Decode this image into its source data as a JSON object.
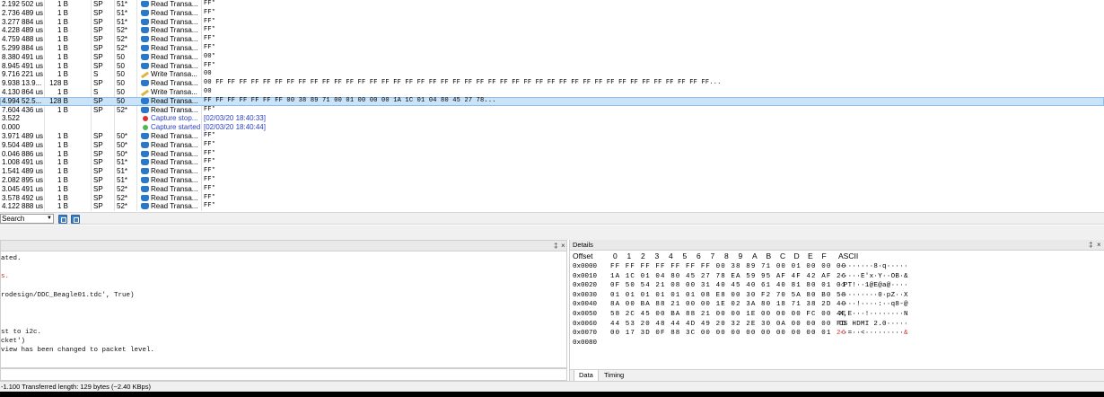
{
  "packets": [
    {
      "time": "2.192",
      "duration": "502 us",
      "length": "1 B",
      "record": "SP",
      "addr": "51*",
      "type": "read",
      "summary": "Read Transa...",
      "data": "FF*"
    },
    {
      "time": "2.736",
      "duration": "489 us",
      "length": "1 B",
      "record": "SP",
      "addr": "51*",
      "type": "read",
      "summary": "Read Transa...",
      "data": "FF*"
    },
    {
      "time": "3.277",
      "duration": "884 us",
      "length": "1 B",
      "record": "SP",
      "addr": "51*",
      "type": "read",
      "summary": "Read Transa...",
      "data": "FF*"
    },
    {
      "time": "4.228",
      "duration": "489 us",
      "length": "1 B",
      "record": "SP",
      "addr": "52*",
      "type": "read",
      "summary": "Read Transa...",
      "data": "FF*"
    },
    {
      "time": "4.759",
      "duration": "488 us",
      "length": "1 B",
      "record": "SP",
      "addr": "52*",
      "type": "read",
      "summary": "Read Transa...",
      "data": "FF*"
    },
    {
      "time": "5.299",
      "duration": "884 us",
      "length": "1 B",
      "record": "SP",
      "addr": "52*",
      "type": "read",
      "summary": "Read Transa...",
      "data": "FF*"
    },
    {
      "time": "8.380",
      "duration": "491 us",
      "length": "1 B",
      "record": "SP",
      "addr": "50",
      "type": "read",
      "summary": "Read Transa...",
      "data": "00*"
    },
    {
      "time": "8.945",
      "duration": "491 us",
      "length": "1 B",
      "record": "SP",
      "addr": "50",
      "type": "read",
      "summary": "Read Transa...",
      "data": "FF*"
    },
    {
      "time": "9.716",
      "duration": "221 us",
      "length": "1 B",
      "record": "S",
      "addr": "50",
      "type": "write",
      "summary": "Write Transa...",
      "data": "00"
    },
    {
      "time": "9.938",
      "duration": "13.9...",
      "length": "128 B",
      "record": "SP",
      "addr": "50",
      "type": "read",
      "summary": "Read Transa...",
      "data": "00 FF FF FF FF FF FF FF FF FF FF FF FF FF FF FF FF FF FF FF FF FF FF FF FF FF FF FF FF FF FF FF FF FF FF FF FF FF FF FF FF FF FF..."
    },
    {
      "time": "4.130",
      "duration": "864 us",
      "length": "1 B",
      "record": "S",
      "addr": "50",
      "type": "write",
      "summary": "Write Transa...",
      "data": "00"
    },
    {
      "time": "4.994",
      "duration": "52.5...",
      "length": "128 B",
      "record": "SP",
      "addr": "50",
      "type": "read",
      "summary": "Read Transa...",
      "data": "FF FF FF FF FF FF FF 00 38 89 71 00 01 00 00 00 1A 1C 01 04 80 45 27 78...",
      "selected": true
    },
    {
      "time": "7.604",
      "duration": "436 us",
      "length": "1 B",
      "record": "SP",
      "addr": "52*",
      "type": "read",
      "summary": "Read Transa...",
      "data": "FF*"
    },
    {
      "time": "3.522",
      "duration": "",
      "length": "",
      "record": "",
      "addr": "",
      "type": "stop",
      "summary": "Capture stop...",
      "data": "[02/03/20 18:40:33]"
    },
    {
      "time": "0.000",
      "duration": "",
      "length": "",
      "record": "",
      "addr": "",
      "type": "start",
      "summary": "Capture started",
      "data": "[02/03/20 18:40:44]"
    },
    {
      "time": "3.971",
      "duration": "489 us",
      "length": "1 B",
      "record": "SP",
      "addr": "50*",
      "type": "read",
      "summary": "Read Transa...",
      "data": "FF*"
    },
    {
      "time": "9.504",
      "duration": "489 us",
      "length": "1 B",
      "record": "SP",
      "addr": "50*",
      "type": "read",
      "summary": "Read Transa...",
      "data": "FF*"
    },
    {
      "time": "0.046",
      "duration": "886 us",
      "length": "1 B",
      "record": "SP",
      "addr": "50*",
      "type": "read",
      "summary": "Read Transa...",
      "data": "FF*"
    },
    {
      "time": "1.008",
      "duration": "491 us",
      "length": "1 B",
      "record": "SP",
      "addr": "51*",
      "type": "read",
      "summary": "Read Transa...",
      "data": "FF*"
    },
    {
      "time": "1.541",
      "duration": "489 us",
      "length": "1 B",
      "record": "SP",
      "addr": "51*",
      "type": "read",
      "summary": "Read Transa...",
      "data": "FF*"
    },
    {
      "time": "2.082",
      "duration": "895 us",
      "length": "1 B",
      "record": "SP",
      "addr": "51*",
      "type": "read",
      "summary": "Read Transa...",
      "data": "FF*"
    },
    {
      "time": "3.045",
      "duration": "491 us",
      "length": "1 B",
      "record": "SP",
      "addr": "52*",
      "type": "read",
      "summary": "Read Transa...",
      "data": "FF*"
    },
    {
      "time": "3.578",
      "duration": "492 us",
      "length": "1 B",
      "record": "SP",
      "addr": "52*",
      "type": "read",
      "summary": "Read Transa...",
      "data": "FF*"
    },
    {
      "time": "4.122",
      "duration": "888 us",
      "length": "1 B",
      "record": "SP",
      "addr": "52*",
      "type": "read",
      "summary": "Read Transa...",
      "data": "FF*"
    }
  ],
  "search": {
    "label": "Search"
  },
  "console": {
    "pin_label": "‡",
    "close_label": "×",
    "lines": [
      {
        "text": "ated.",
        "red": false
      },
      {
        "text": "",
        "red": false
      },
      {
        "text": "s.",
        "red": true
      },
      {
        "text": "",
        "red": false
      },
      {
        "text": "rodesign/DDC_Beagle01.tdc', True)",
        "red": false
      },
      {
        "text": "",
        "red": false
      },
      {
        "text": "",
        "red": false
      },
      {
        "text": "",
        "red": false
      },
      {
        "text": "st to i2c.",
        "red": false
      },
      {
        "text": "cket')",
        "red": false
      },
      {
        "text": "view has been changed to packet level.",
        "red": false
      }
    ]
  },
  "details": {
    "title": "Details",
    "headers": {
      "offset": "Offset",
      "columns": [
        "0",
        "1",
        "2",
        "3",
        "4",
        "5",
        "6",
        "7",
        "8",
        "9",
        "A",
        "B",
        "C",
        "D",
        "E",
        "F"
      ],
      "ascii": "ASCII"
    },
    "rows": [
      {
        "offset": "0x0000",
        "bytes": "FF FF FF FF FF FF FF 00 38 89 71 00 01 00 00 00",
        "ascii": "········8·q·····"
      },
      {
        "offset": "0x0010",
        "bytes": "1A 1C 01 04 80 45 27 78 EA 59 95 AF 4F 42 AF 26",
        "ascii": "·····E'x·Y··OB·&"
      },
      {
        "offset": "0x0020",
        "bytes": "0F 50 54 21 08 00 31 40 45 40 61 40 81 80 01 01",
        "ascii": "·PT!··1@E@a@····"
      },
      {
        "offset": "0x0030",
        "bytes": "01 01 01 01 01 01 08 E8 00 30 F2 70 5A 80 B0 58",
        "ascii": "·········0·pZ··X"
      },
      {
        "offset": "0x0040",
        "bytes": "8A 00 BA 88 21 00 00 1E 02 3A 80 18 71 38 2D 40",
        "ascii": "····!····:··q8-@"
      },
      {
        "offset": "0x0050",
        "bytes": "58 2C 45 00 BA 88 21 00 00 1E 00 00 00 FC 00 4E",
        "ascii": "X,E···!········N"
      },
      {
        "offset": "0x0060",
        "bytes": "44 53 20 48 44 4D 49 20 32 2E 30 0A 00 00 00 FD",
        "ascii": "DS HDMI 2.0·····"
      },
      {
        "offset": "0x0070",
        "bytes": "00 17 3D 0F 88 3C 00 00 00 00 00 00 00 00 01",
        "hl_byte": "26",
        "ascii": "··=··<·········",
        "hl_ascii": "&"
      },
      {
        "offset": "0x0080",
        "bytes": "",
        "ascii": ""
      }
    ],
    "tabs": [
      {
        "label": "Data",
        "active": true
      },
      {
        "label": "Timing",
        "active": false
      }
    ],
    "pin_label": "‡",
    "close_label": "×"
  },
  "status": {
    "text": "-1.100   Transferred length: 129 bytes (~2.40 KBps)"
  },
  "colors": {
    "selected_row": "#cbe3f7",
    "link_blue": "#2a3ec2",
    "read_icon": "#2a78c8",
    "write_icon": "#e2b23a",
    "stop_icon": "#e03030",
    "start_icon": "#4fb84f",
    "highlight_red": "#d23030"
  }
}
